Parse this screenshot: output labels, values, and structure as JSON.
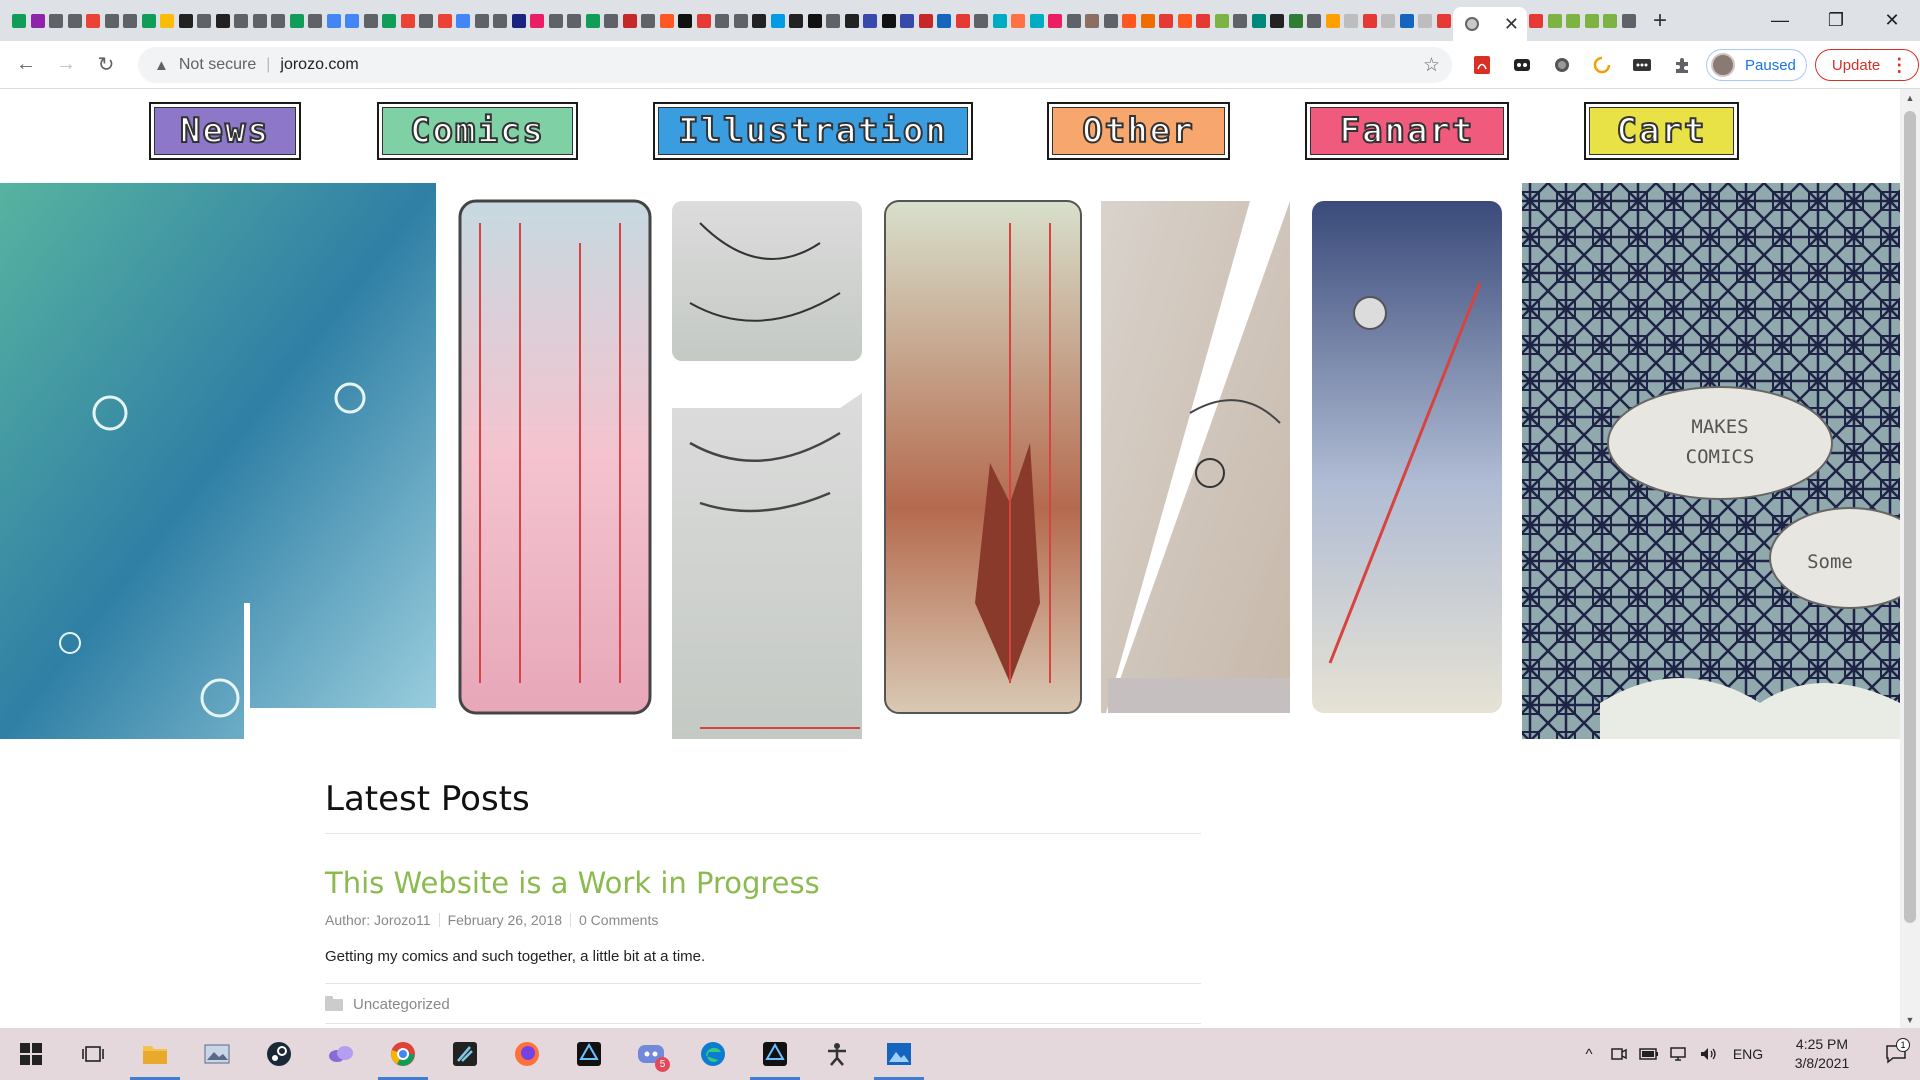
{
  "browser": {
    "active_tab_close": "✕",
    "new_tab": "+",
    "window": {
      "minimize": "—",
      "restore": "❐",
      "close": "✕"
    },
    "nav": {
      "back": "←",
      "forward": "→",
      "reload": "↻"
    },
    "address": {
      "security_icon": "▲",
      "security_label": "Not secure",
      "separator": "|",
      "url": "jorozo.com",
      "bookmark_icon": "☆"
    },
    "profile": {
      "label": "Paused"
    },
    "update": {
      "label": "Update",
      "menu": "⋮"
    },
    "tab_favicon_colors": [
      "#0f9d58",
      "#8e24aa",
      "#5f6368",
      "#5f6368",
      "#ea4335",
      "#5f6368",
      "#5f6368",
      "#0f9d58",
      "#fbbc05",
      "#222",
      "#5f6368",
      "#222",
      "#5f6368",
      "#5f6368",
      "#5f6368",
      "#0f9d58",
      "#5f6368",
      "#4285f4",
      "#4285f4",
      "#5f6368",
      "#0f9d58",
      "#ea4335",
      "#5f6368",
      "#ea4335",
      "#4285f4",
      "#5f6368",
      "#5f6368",
      "#1a237e",
      "#e91e63",
      "#5f6368",
      "#5f6368",
      "#0f9d58",
      "#5f6368",
      "#c62828",
      "#5f6368",
      "#ff5722",
      "#111",
      "#e53935",
      "#5f6368",
      "#5f6368",
      "#222",
      "#039be5",
      "#222",
      "#111",
      "#5f6368",
      "#222",
      "#3949ab",
      "#111",
      "#3949ab",
      "#c62828",
      "#1565c0",
      "#e53935",
      "#5f6368",
      "#00acc1",
      "#ff7043",
      "#00acc1",
      "#e91e63",
      "#5f6368",
      "#8d6e63",
      "#5f6368",
      "#ff5722",
      "#ef6c00",
      "#e53935",
      "#ff5722",
      "#e53935",
      "#7cb342",
      "#5f6368",
      "#00897b",
      "#222",
      "#2e7d32",
      "#5f6368",
      "#ffa000",
      "#bdbdbd",
      "#e53935",
      "#bdbdbd",
      "#1565c0",
      "#bdbdbd",
      "#e53935",
      "#e53935",
      "#7cb342",
      "#7cb342",
      "#7cb342",
      "#7cb342",
      "#5f6368",
      "#7cb342",
      "#7cb342",
      "#ffb300",
      "#ff7043",
      "#e53935",
      "#e53935"
    ]
  },
  "site": {
    "nav": [
      {
        "label": "News",
        "color": "#8d77c9"
      },
      {
        "label": "Comics",
        "color": "#7fd0a4"
      },
      {
        "label": "Illustration",
        "color": "#3a9de0"
      },
      {
        "label": "Other",
        "color": "#f7a66e"
      },
      {
        "label": "Fanart",
        "color": "#ef5a7d"
      },
      {
        "label": "Cart",
        "color": "#e9e246"
      }
    ],
    "banner": {
      "bubble_text_1": "MAKES",
      "bubble_text_2": "COMICS",
      "bubble_text_3": "Some"
    },
    "latest_posts_heading": "Latest Posts",
    "post": {
      "title": "This Website is a Work in Progress",
      "author": "Author: Jorozo11",
      "date": "February 26, 2018",
      "comments": "0 Comments",
      "excerpt": "Getting my comics and such together, a little bit at a time.",
      "category": "Uncategorized"
    }
  },
  "taskbar": {
    "discord_badge": "5",
    "tray": {
      "chevron": "^",
      "lang": "ENG",
      "time": "4:25 PM",
      "date": "3/8/2021",
      "notif_count": "1"
    }
  }
}
